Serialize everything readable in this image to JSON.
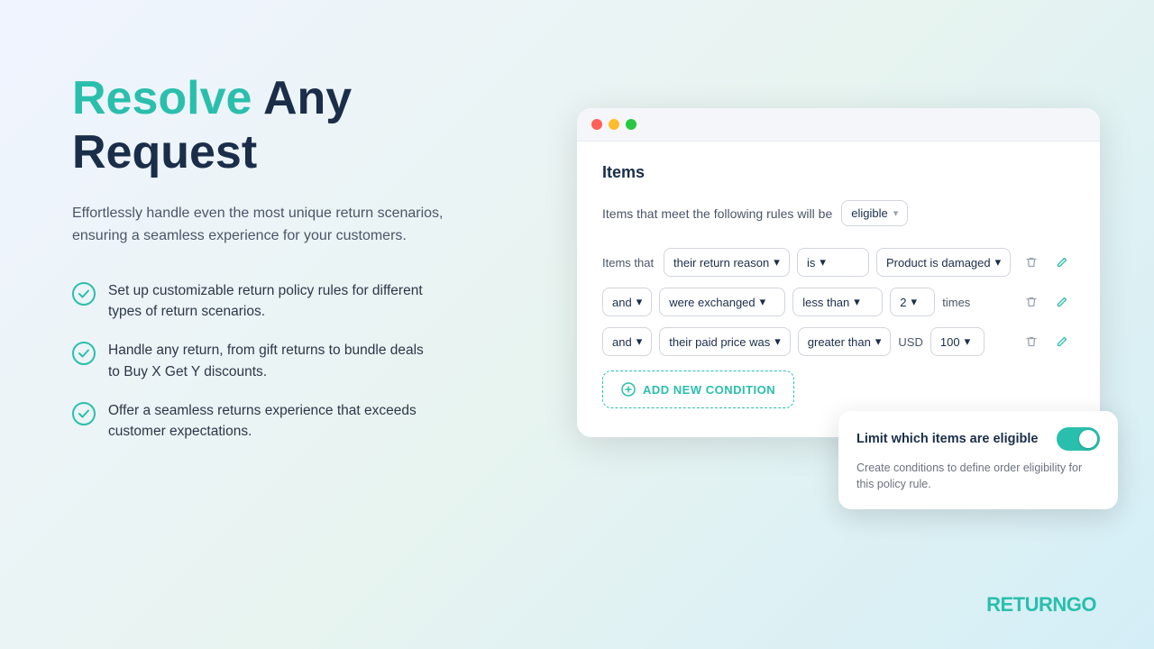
{
  "hero": {
    "headline_green": "Resolve",
    "headline_dark": " Any\nRequest",
    "subtitle": "Effortlessly handle even the most unique return scenarios, ensuring a seamless experience for your customers."
  },
  "features": [
    {
      "id": "f1",
      "text": "Set up customizable return policy rules for different types of return scenarios."
    },
    {
      "id": "f2",
      "text": "Handle any return, from gift returns to bundle deals to Buy X Get Y discounts."
    },
    {
      "id": "f3",
      "text": "Offer a seamless returns experience that exceeds customer expectations."
    }
  ],
  "panel": {
    "section_title": "Items",
    "eligibility_text": "Items that meet the following rules will be",
    "eligibility_value": "eligible",
    "conditions": [
      {
        "prefix": "Items that",
        "field": "their return reason",
        "operator": "is",
        "value": "Product is damaged",
        "suffix": ""
      },
      {
        "prefix": "and",
        "field": "were exchanged",
        "operator": "less than",
        "value": "2",
        "suffix": "times"
      },
      {
        "prefix": "and",
        "field": "their paid price was",
        "operator": "greater than",
        "value": "100",
        "currency": "USD",
        "suffix": ""
      }
    ],
    "add_condition_label": "ADD NEW CONDITION"
  },
  "tooltip": {
    "title": "Limit which items are eligible",
    "description": "Create conditions to define order eligibility for this policy rule.",
    "toggle_on": true
  },
  "logo": {
    "text_dark": "RETURN",
    "text_green": "GO"
  }
}
